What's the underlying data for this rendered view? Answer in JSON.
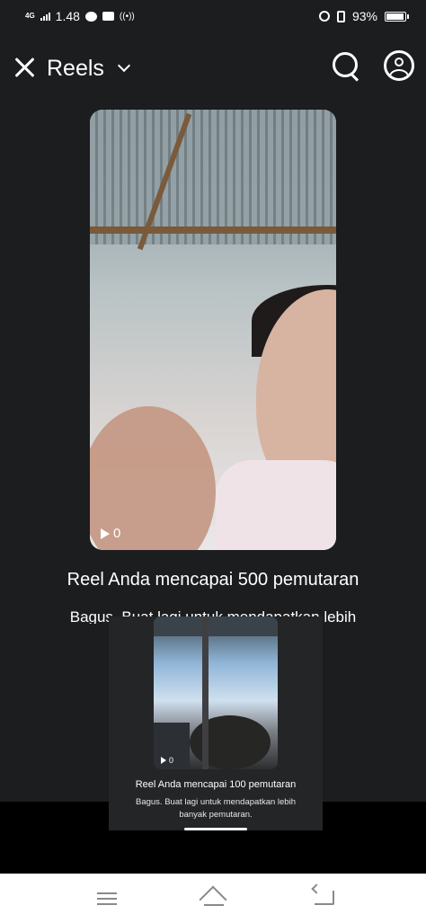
{
  "status_bar": {
    "network": "4G",
    "time": "1.48",
    "battery": "93%",
    "battery_level": 0.93
  },
  "header": {
    "title": "Reels"
  },
  "reel_1": {
    "play_count": "0",
    "message": "Reel Anda mencapai 500 pemutaran",
    "sub": "Bagus. Buat lagi untuk mendapatkan lebih"
  },
  "reel_2": {
    "play_count": "0",
    "message": "Reel Anda mencapai 100 pemutaran",
    "sub": "Bagus. Buat lagi untuk mendapatkan lebih banyak pemutaran."
  },
  "icons": {
    "close": "close-icon",
    "dropdown": "chevron-down-icon",
    "search": "search-icon",
    "profile": "profile-icon",
    "menu": "menu-icon",
    "home": "home-icon",
    "back": "back-icon"
  }
}
